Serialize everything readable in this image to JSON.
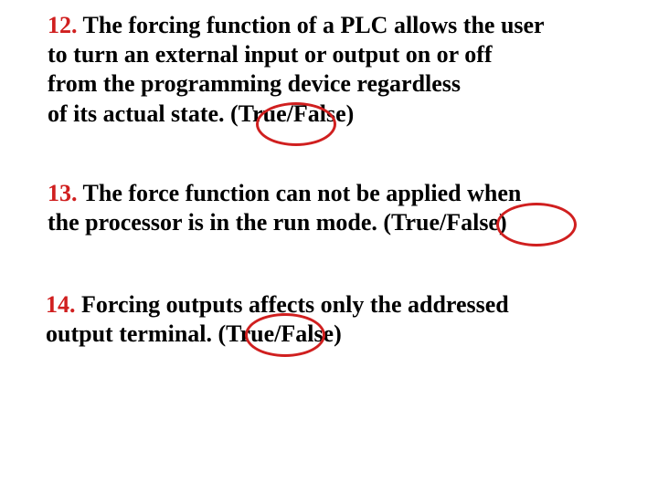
{
  "questions": {
    "q12": {
      "number": "12.",
      "line1": " The forcing function of a PLC allows the user",
      "line2": "to turn an external input or output on or off",
      "line3": "from the programming device regardless",
      "line4": "of its actual state. (True/False)"
    },
    "q13": {
      "number": "13.",
      "line1": " The force function can not be applied when",
      "line2": " the processor is in the run mode. (True/False)"
    },
    "q14": {
      "number": "14.",
      "line1": " Forcing outputs affects only the addressed",
      "line2": "output  terminal. (True/False)"
    }
  }
}
